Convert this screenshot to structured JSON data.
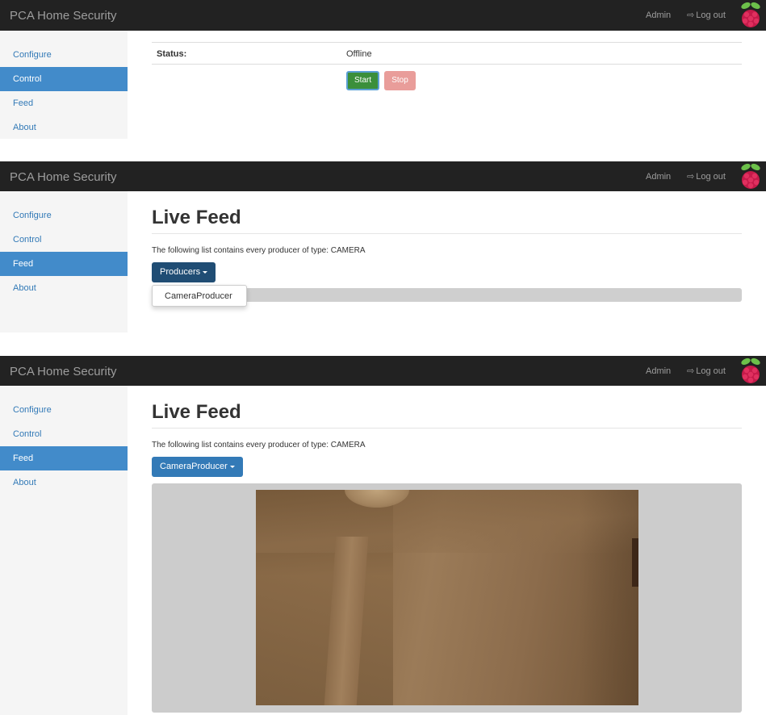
{
  "app": {
    "brand": "PCA Home Security",
    "admin_label": "Admin",
    "logout_label": "Log out",
    "logout_icon": "sign-out-icon",
    "logo_icon": "raspberry-pi-logo"
  },
  "colors": {
    "navbar": "#222222",
    "sidebar": "#f5f5f5",
    "active": "#428bca",
    "link": "#337ab7",
    "start": "#3b8f3b",
    "stop": "#e99d9a"
  },
  "sidebar": {
    "items": [
      {
        "label": "Configure"
      },
      {
        "label": "Control"
      },
      {
        "label": "Feed"
      },
      {
        "label": "About"
      }
    ]
  },
  "control_panel": {
    "active_item": "Control",
    "status_label": "Status:",
    "status_value": "Offline",
    "start_label": "Start",
    "stop_label": "Stop"
  },
  "feed_panel": {
    "active_item": "Feed",
    "title": "Live Feed",
    "description": "The following list contains every producer of type: CAMERA",
    "dropdown_label": "Producers",
    "dropdown_options": [
      "CameraProducer"
    ]
  },
  "feed_panel_selected": {
    "active_item": "Feed",
    "title": "Live Feed",
    "description": "The following list contains every producer of type: CAMERA",
    "dropdown_label": "CameraProducer"
  }
}
